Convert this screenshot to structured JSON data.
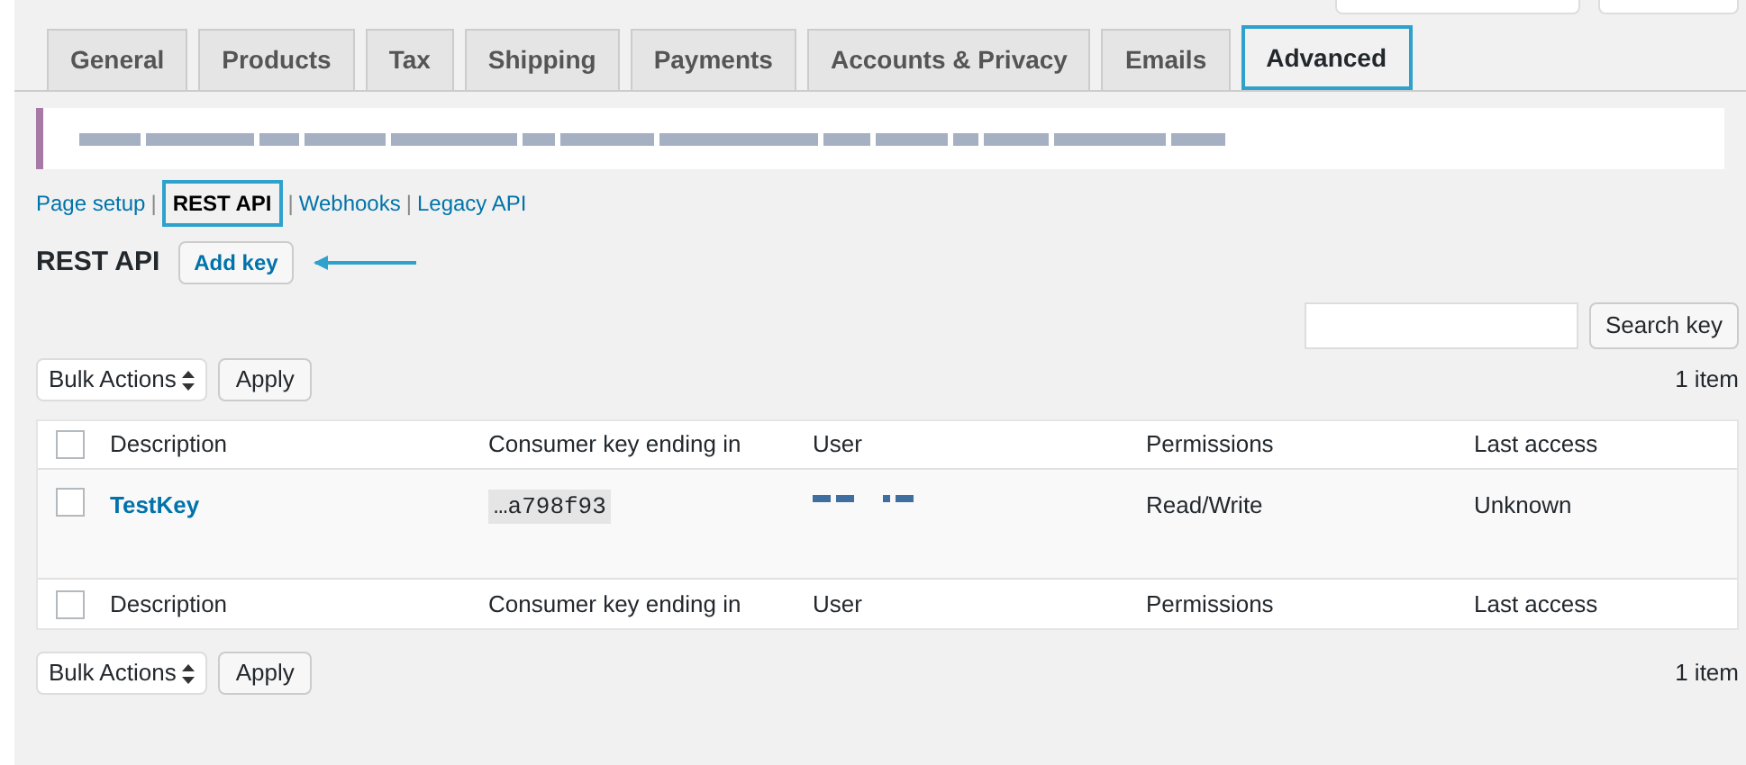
{
  "tabs": [
    {
      "label": "General",
      "selected": false
    },
    {
      "label": "Products",
      "selected": false
    },
    {
      "label": "Tax",
      "selected": false
    },
    {
      "label": "Shipping",
      "selected": false
    },
    {
      "label": "Payments",
      "selected": false
    },
    {
      "label": "Accounts & Privacy",
      "selected": false
    },
    {
      "label": "Emails",
      "selected": false
    },
    {
      "label": "Advanced",
      "selected": true
    }
  ],
  "subnav": [
    {
      "label": "Page setup",
      "selected": false
    },
    {
      "separator": "|",
      "label": "REST API",
      "selected": true
    },
    {
      "separator": "|",
      "label": "Webhooks",
      "selected": false
    },
    {
      "separator": "|",
      "label": "Legacy API",
      "selected": false
    }
  ],
  "heading": "REST API",
  "add_button": "Add key",
  "search": {
    "button": "Search key"
  },
  "top_actions": {
    "bulk": "Bulk Actions",
    "apply": "Apply",
    "count": "1 item"
  },
  "table": {
    "header_checked": false,
    "footer_checked": false,
    "columns": [
      "Description",
      "Consumer key ending in",
      "User",
      "Permissions",
      "Last access"
    ],
    "rows": [
      {
        "description": "TestKey",
        "key": "…a798f93",
        "permissions": "Read/Write",
        "last_access": "Unknown",
        "checked": false
      }
    ],
    "footer": [
      "Description",
      "Consumer key ending in",
      "User",
      "Permissions",
      "Last access"
    ]
  },
  "bottom_actions": {
    "bulk": "Bulk Actions",
    "apply": "Apply",
    "count": "1 item"
  }
}
